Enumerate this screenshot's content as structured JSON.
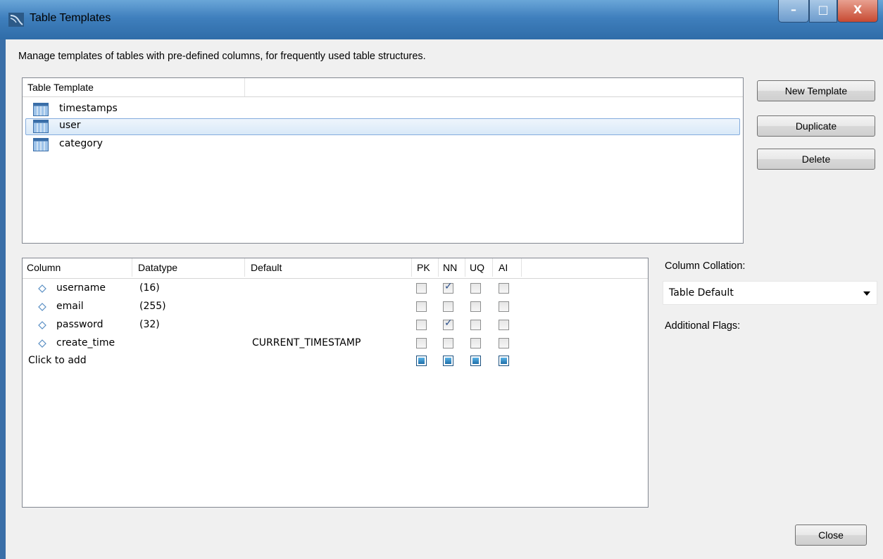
{
  "window": {
    "title": "Table Templates",
    "buttons": {
      "minimize": "–",
      "maximize": "□",
      "close": "X"
    }
  },
  "description": "Manage templates of tables with pre-defined columns, for frequently used table structures.",
  "templates": {
    "header": "Table Template",
    "items": [
      {
        "label": "timestamps",
        "selected": false,
        "icon": "table-icon"
      },
      {
        "label": "user",
        "selected": true,
        "icon": "table-icon"
      },
      {
        "label": "category",
        "selected": false,
        "icon": "table-icon"
      }
    ]
  },
  "template_buttons": {
    "new": "New Template",
    "duplicate": "Duplicate",
    "delete": "Delete"
  },
  "columns": {
    "headers": {
      "column": "Column",
      "datatype": "Datatype",
      "default": "Default",
      "pk": "PK",
      "nn": "NN",
      "uq": "UQ",
      "ai": "AI"
    },
    "rows": [
      {
        "name": "username",
        "datatype": "(16)",
        "default": "",
        "pk": false,
        "nn": true,
        "uq": false,
        "ai": false
      },
      {
        "name": "email",
        "datatype": "(255)",
        "default": "",
        "pk": false,
        "nn": false,
        "uq": false,
        "ai": false
      },
      {
        "name": "password",
        "datatype": "(32)",
        "default": "",
        "pk": false,
        "nn": true,
        "uq": false,
        "ai": false
      },
      {
        "name": "create_time",
        "datatype": "",
        "default": "CURRENT_TIMESTAMP",
        "pk": false,
        "nn": false,
        "uq": false,
        "ai": false
      }
    ],
    "add_row": "Click to add"
  },
  "collation": {
    "label": "Column Collation:",
    "value": "Table Default",
    "flags_label": "Additional Flags:"
  },
  "close_button": "Close",
  "colors": {
    "titlebar": "#3f7fbd",
    "selection": "#d9e9f8",
    "selection_border": "#84acdd"
  }
}
